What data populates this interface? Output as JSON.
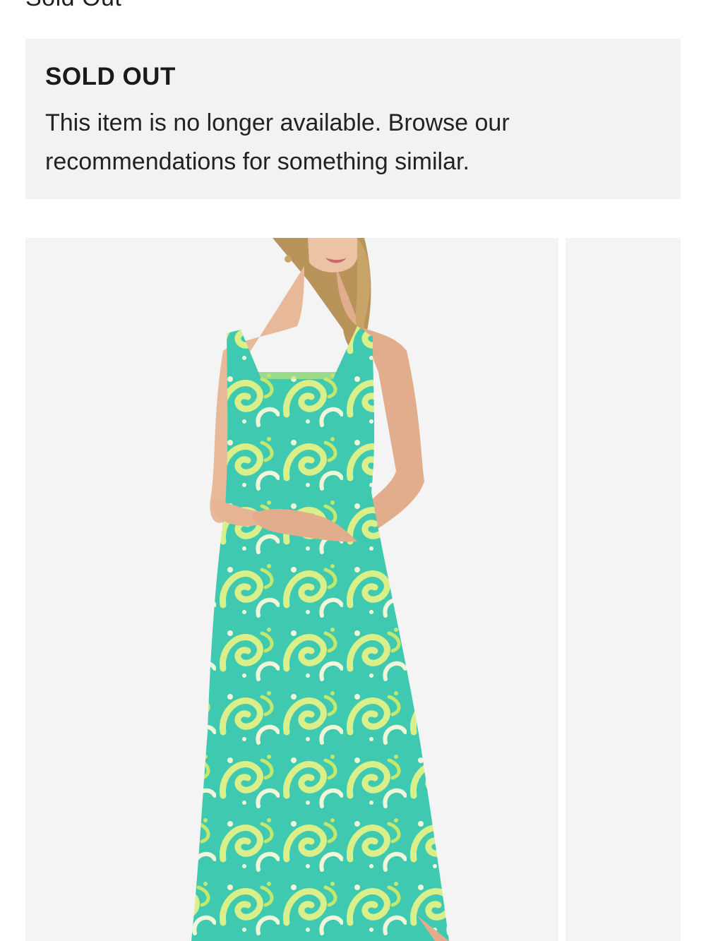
{
  "header": {
    "status_text": "Sold Out"
  },
  "notice": {
    "title": "SOLD OUT",
    "message": "This item is no longer available. Browse our recommendations for something similar."
  },
  "gallery": {
    "images": [
      {
        "alt": "Woman wearing a sleeveless turquoise and lime paisley print maxi dress"
      },
      {
        "alt": ""
      }
    ]
  },
  "colors": {
    "notice_bg": "#f2f2f3",
    "photo_bg": "#f4f4f5",
    "dress_base": "#3ec9b0",
    "dress_print": "#d8ef8a"
  }
}
